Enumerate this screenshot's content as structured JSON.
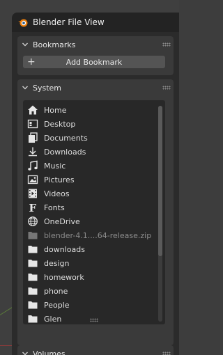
{
  "window": {
    "title": "Blender File View"
  },
  "bookmarks": {
    "header": "Bookmarks",
    "add_label": "Add Bookmark"
  },
  "system": {
    "header": "System",
    "items": [
      {
        "label": "Home",
        "icon": "home-icon",
        "dim": false
      },
      {
        "label": "Desktop",
        "icon": "desktop-icon",
        "dim": false
      },
      {
        "label": "Documents",
        "icon": "documents-icon",
        "dim": false
      },
      {
        "label": "Downloads",
        "icon": "downloads-icon",
        "dim": false
      },
      {
        "label": "Music",
        "icon": "music-icon",
        "dim": false
      },
      {
        "label": "Pictures",
        "icon": "pictures-icon",
        "dim": false
      },
      {
        "label": "Videos",
        "icon": "videos-icon",
        "dim": false
      },
      {
        "label": "Fonts",
        "icon": "fonts-icon",
        "dim": false
      },
      {
        "label": "OneDrive",
        "icon": "globe-icon",
        "dim": false
      },
      {
        "label": "blender-4.1....64-release.zip",
        "icon": "folder-icon",
        "dim": true
      },
      {
        "label": "downloads",
        "icon": "folder-icon",
        "dim": false
      },
      {
        "label": "design",
        "icon": "folder-icon",
        "dim": false
      },
      {
        "label": "homework",
        "icon": "folder-icon",
        "dim": false
      },
      {
        "label": "phone",
        "icon": "folder-icon",
        "dim": false
      },
      {
        "label": "People",
        "icon": "folder-icon",
        "dim": false
      },
      {
        "label": "Glen",
        "icon": "folder-icon",
        "dim": false
      }
    ]
  },
  "volumes": {
    "header": "Volumes"
  },
  "colors": {
    "accent": "#e87d0d",
    "panel": "#3a3a3a",
    "list_bg": "#282828"
  }
}
